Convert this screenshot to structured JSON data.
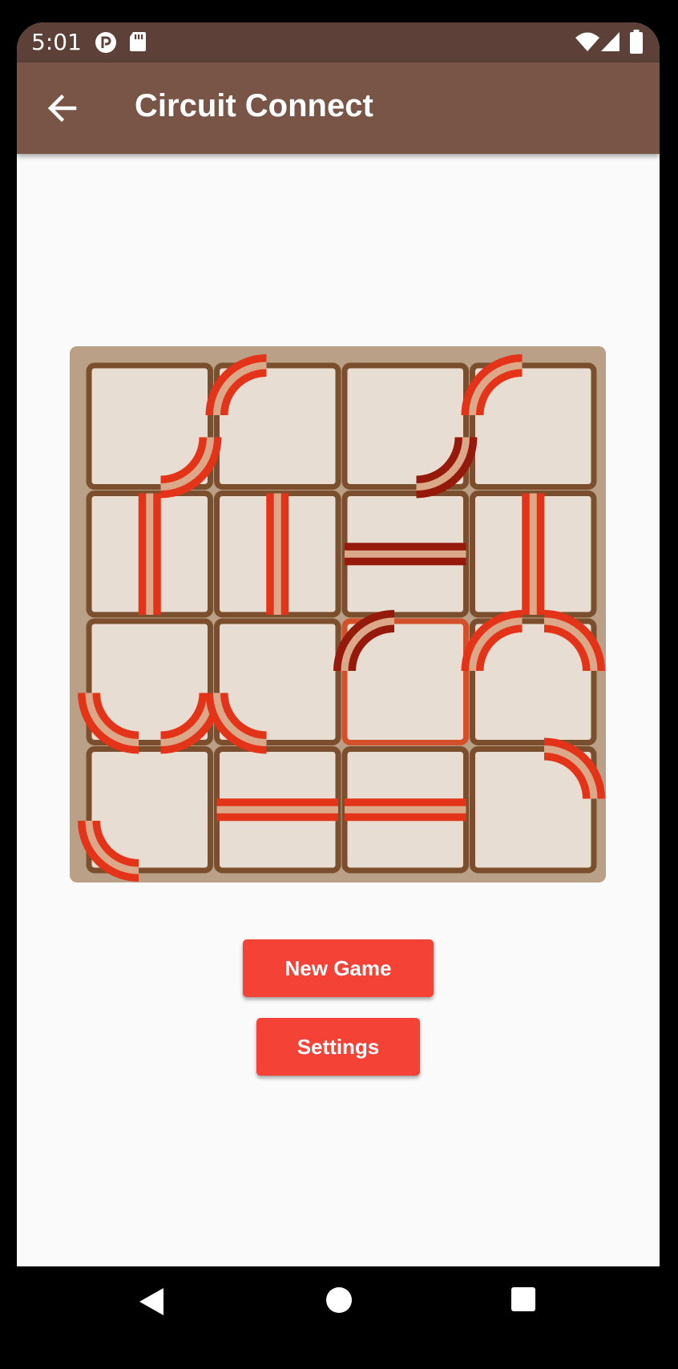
{
  "status_bar": {
    "time": "5:01",
    "icons": [
      "cast-icon",
      "sd-card-icon",
      "wifi-icon",
      "cellular-signal-icon",
      "battery-icon"
    ]
  },
  "app_bar": {
    "title": "Circuit Connect",
    "back_icon": "arrow-back-icon"
  },
  "game": {
    "rows": 4,
    "cols": 4,
    "tiles": [
      [
        "q11",
        "q00",
        "q11",
        "q00"
      ],
      [
        "v",
        "v",
        "h",
        "v"
      ],
      [
        "q01+q11",
        "q01",
        "q00",
        "q10+q00"
      ],
      [
        "q01",
        "h",
        "h",
        "q10"
      ]
    ],
    "selected_tile": {
      "row": 2,
      "col": 2
    },
    "dark_wire_tiles": [
      [
        0,
        2
      ],
      [
        1,
        2
      ],
      [
        2,
        2
      ]
    ]
  },
  "buttons": {
    "new_game": "New Game",
    "settings": "Settings"
  },
  "nav_bar": {
    "icons": [
      "back-triangle-icon",
      "home-circle-icon",
      "recents-square-icon"
    ]
  },
  "colors": {
    "status_bar": "#5d4037",
    "app_bar": "#795548",
    "board_bg": "#b9a087",
    "tile_fill": "#e7ddd3",
    "tile_border": "#7b4f2d",
    "tile_selected_border": "#d4502a",
    "wire_bright": "#e3341a",
    "wire_dark": "#961a0c",
    "wire_core": "#dba88a",
    "button": "#f44336"
  }
}
